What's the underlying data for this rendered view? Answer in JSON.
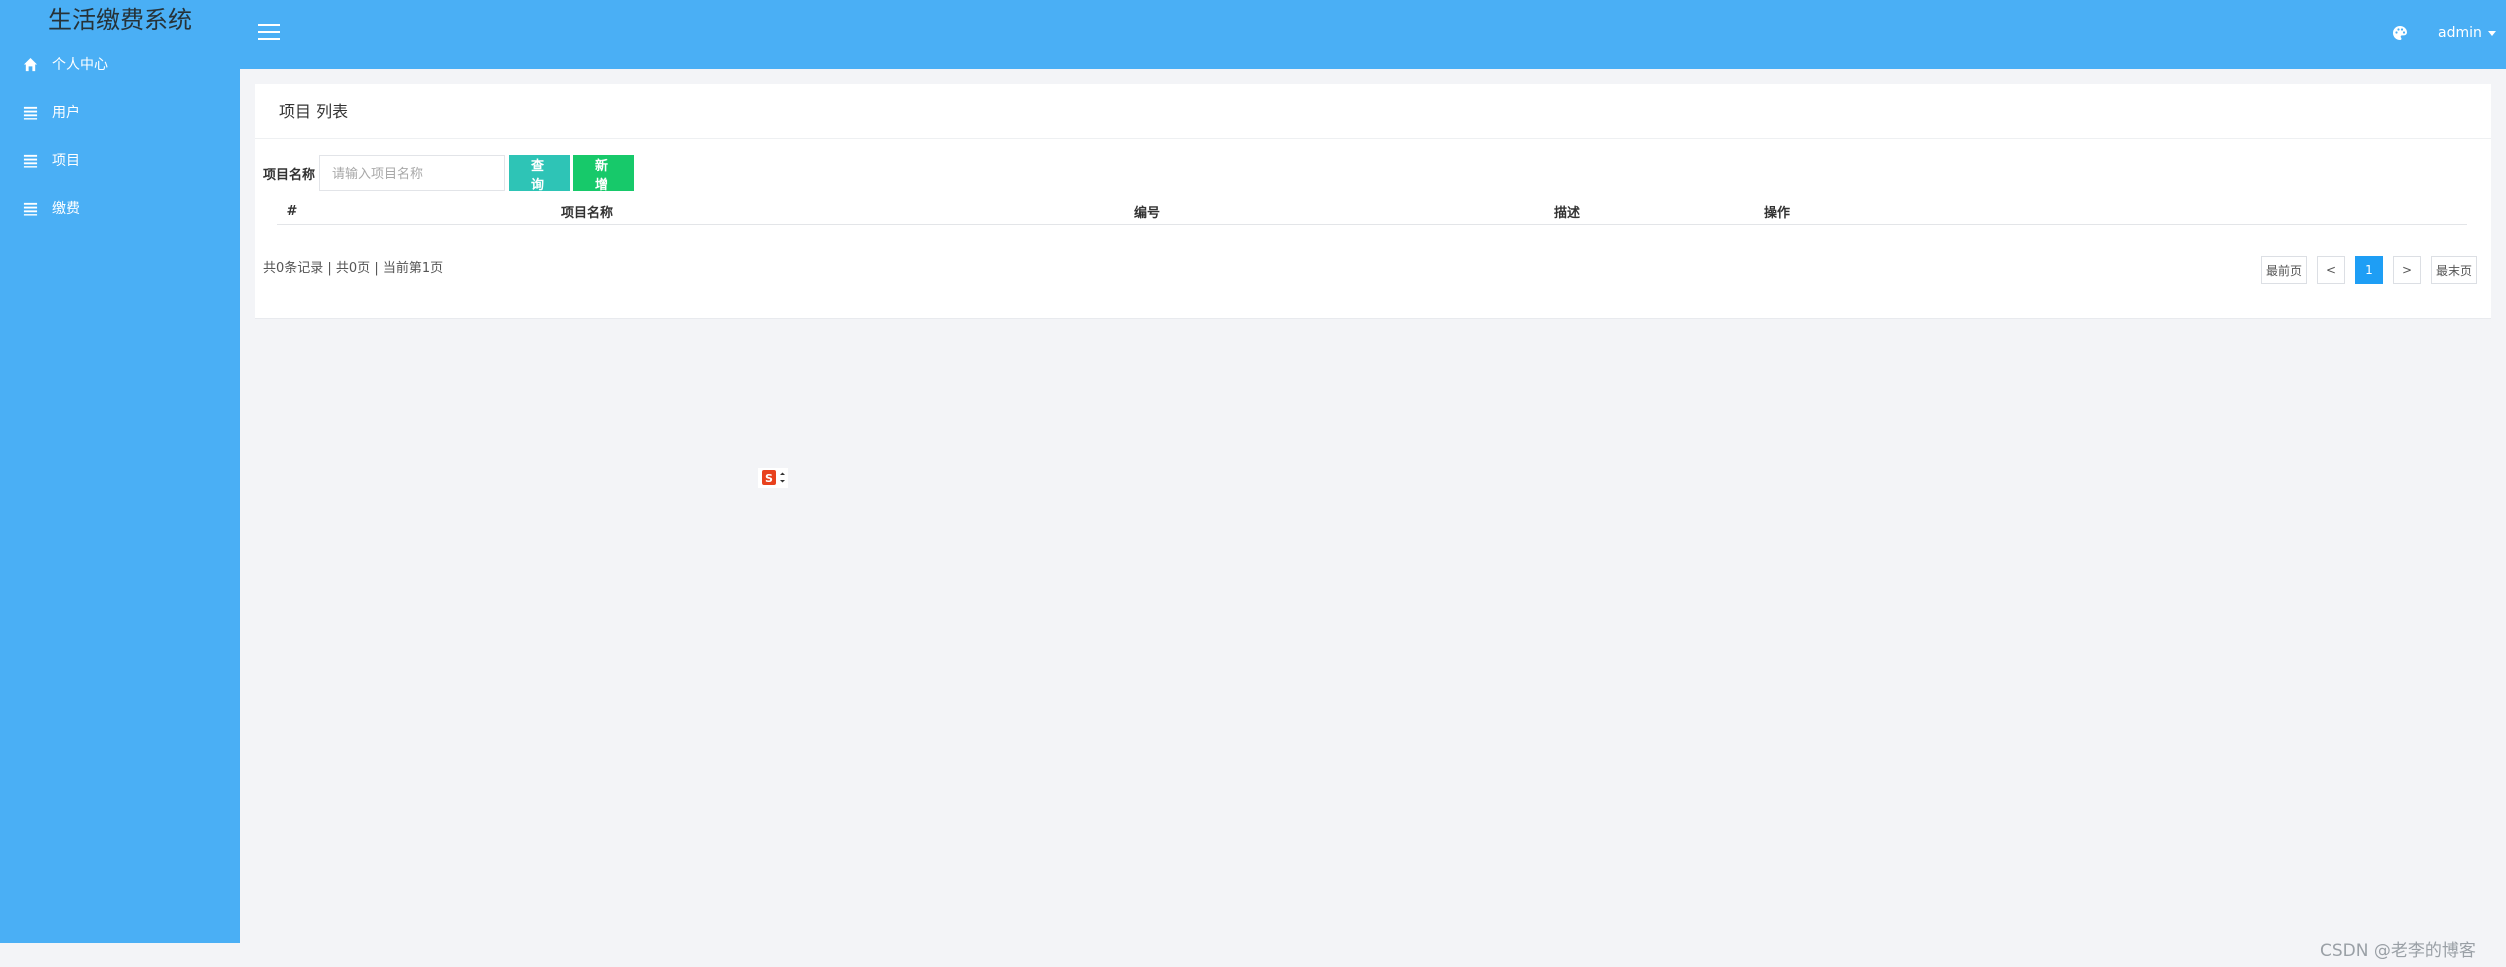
{
  "app": {
    "title": "生活缴费系统"
  },
  "sidebar": {
    "items": [
      {
        "label": "个人中心",
        "icon": "home-icon"
      },
      {
        "label": "用户",
        "icon": "list-icon"
      },
      {
        "label": "项目",
        "icon": "list-icon"
      },
      {
        "label": "缴费",
        "icon": "list-icon"
      }
    ]
  },
  "topbar": {
    "user": "admin",
    "theme_icon": "palette-icon",
    "menu_icon": "hamburger-icon"
  },
  "main": {
    "panel_title": "项目 列表",
    "search": {
      "label": "项目名称",
      "placeholder": "请输入项目名称",
      "value": ""
    },
    "buttons": {
      "query": "查 询",
      "add": "新 增"
    },
    "table": {
      "columns": [
        "#",
        "项目名称",
        "编号",
        "描述",
        "操作"
      ],
      "rows": []
    },
    "records": "共0条记录 | 共0页 | 当前第1页",
    "pagination": {
      "first": "最前页",
      "prev": "<",
      "current": "1",
      "next": ">",
      "last": "最末页"
    }
  },
  "watermark": "CSDN @老李的博客",
  "colors": {
    "sidebar": "#4aaff5",
    "query_button": "#2ec4b6",
    "add_button": "#17c96a",
    "active_page": "#1e9ef5"
  }
}
